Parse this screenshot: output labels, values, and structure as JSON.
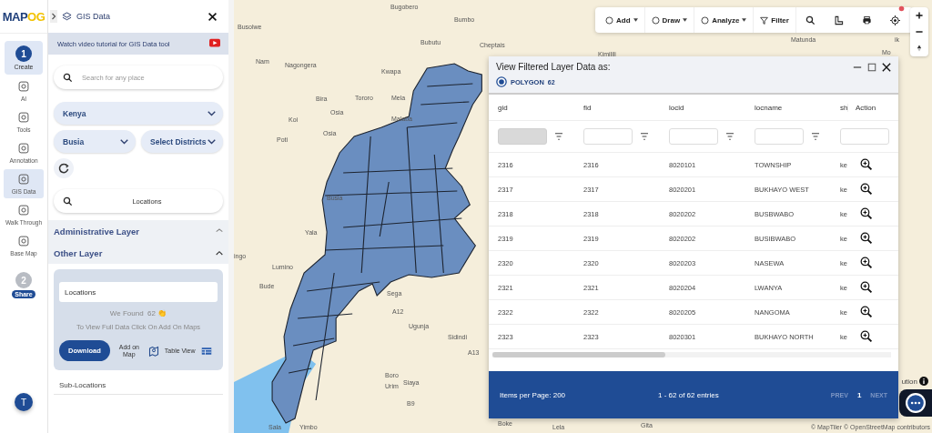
{
  "logo": {
    "main": "MAP",
    "accent": "OG"
  },
  "rail": {
    "items": [
      {
        "kind": "step",
        "label": "Create",
        "number": "1",
        "selected": true
      },
      {
        "kind": "tool",
        "label": "AI",
        "selected": false
      },
      {
        "kind": "tool",
        "label": "Tools",
        "selected": false
      },
      {
        "kind": "tool",
        "label": "Annotation",
        "selected": false
      },
      {
        "kind": "tool",
        "label": "GIS Data",
        "selected": true
      },
      {
        "kind": "tool",
        "label": "Walk Through",
        "selected": false
      },
      {
        "kind": "tool",
        "label": "Base Map",
        "selected": false
      },
      {
        "kind": "step",
        "label": "Share",
        "number": "2",
        "selected": false
      }
    ],
    "avatar": "T"
  },
  "panel": {
    "title": "GIS Data",
    "banner": "Watch video tutorial for GIS Data tool",
    "search": {
      "placeholder": "Search for any place"
    },
    "country": "Kenya",
    "county": "Busia",
    "district": {
      "placeholder": "Select Districts"
    },
    "layer_search": {
      "value": "Locations"
    },
    "sections": [
      {
        "title": "Administrative Layer",
        "expanded": false
      },
      {
        "title": "Other Layer",
        "expanded": true
      }
    ],
    "card": {
      "field": "Locations",
      "found": "We Found  62 👏",
      "hint": "To View Full Data Click On Add On Maps",
      "download": "Download",
      "add_on_map": "Add on Map",
      "table_view": "Table View"
    },
    "next_item": "Sub-Locations"
  },
  "toolbar": [
    {
      "kind": "menu",
      "label": "Add"
    },
    {
      "kind": "menu",
      "label": "Draw"
    },
    {
      "kind": "menu",
      "label": "Analyze"
    },
    {
      "kind": "button",
      "label": "Filter"
    },
    {
      "kind": "search"
    },
    {
      "kind": "measure"
    },
    {
      "kind": "print"
    },
    {
      "kind": "locate"
    }
  ],
  "map": {
    "places": [
      "Bugobero",
      "Bumbo",
      "Busolwe",
      "Bubutu",
      "Cheptais",
      "Nam",
      "Nagongera",
      "Kwapa",
      "Bira",
      "Tororo",
      "Mela",
      "Osia",
      "Koi",
      "Malaba",
      "Osia",
      "Poti",
      "Busia",
      "Yala",
      "ingo",
      "Lumino",
      "Bude",
      "Sega",
      "A12",
      "Ugunja",
      "Sidindi",
      "A13",
      "Boro",
      "Urim",
      "Siaya",
      "B9",
      "Sala",
      "Yimbo",
      "Matunda",
      "Kimilili",
      "ik",
      "Mo",
      "Boke",
      "Lela",
      "Gita"
    ],
    "attribution": "ution",
    "copyright": "© MapTiler © OpenStreetMap contributors"
  },
  "layer_window": {
    "title": "View Filtered Layer Data as:",
    "layers": [
      {
        "label": "POLYGON",
        "count": "62",
        "selected": true
      }
    ],
    "table": {
      "columns": [
        {
          "label": "gid",
          "filter_disabled": true
        },
        {
          "label": "fid",
          "filter_disabled": false
        },
        {
          "label": "locid",
          "filter_disabled": false
        },
        {
          "label": "locname",
          "filter_disabled": false
        },
        {
          "label": "sh",
          "filter_disabled": false
        }
      ],
      "action_label": "Action",
      "rows": [
        [
          "2316",
          "2316",
          "8020101",
          "TOWNSHIP",
          "ke"
        ],
        [
          "2317",
          "2317",
          "8020201",
          "BUKHAYO WEST",
          "ke"
        ],
        [
          "2318",
          "2318",
          "8020202",
          "BUSBWABO",
          "ke"
        ],
        [
          "2319",
          "2319",
          "8020202",
          "BUSIBWABO",
          "ke"
        ],
        [
          "2320",
          "2320",
          "8020203",
          "NASEWA",
          "ke"
        ],
        [
          "2321",
          "2321",
          "8020204",
          "LWANYA",
          "ke"
        ],
        [
          "2322",
          "2322",
          "8020205",
          "NANGOMA",
          "ke"
        ],
        [
          "2323",
          "2323",
          "8020301",
          "BUKHAYO NORTH",
          "ke"
        ]
      ]
    },
    "footer": {
      "per_page": "Items per Page: 200",
      "range": "1 - 62 of 62 entries",
      "prev": {
        "label": "PREV",
        "disabled": true
      },
      "page": "1",
      "next": {
        "label": "NEXT",
        "disabled": true
      }
    }
  }
}
